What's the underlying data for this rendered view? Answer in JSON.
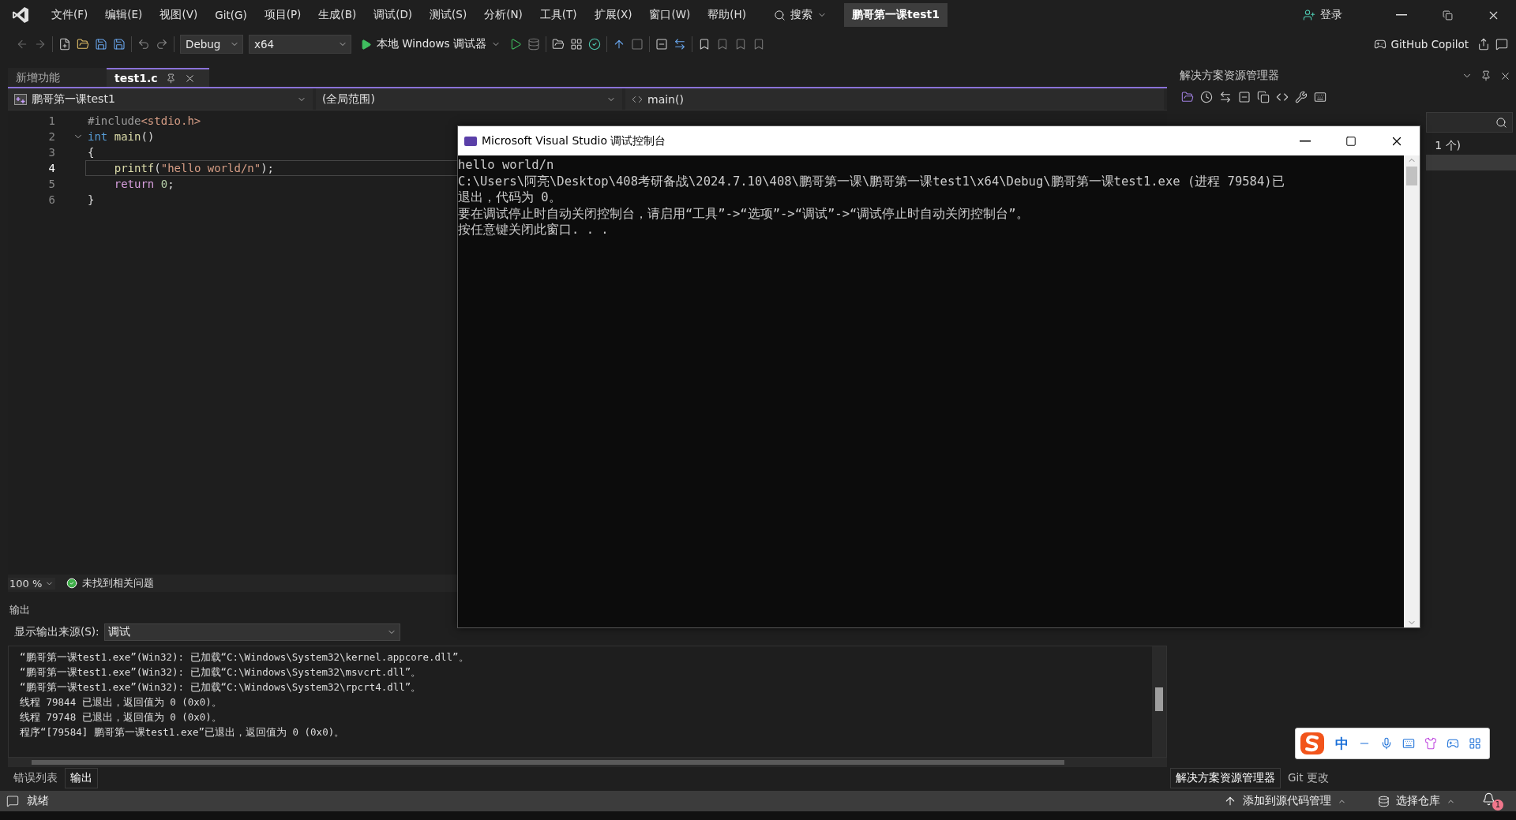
{
  "menu_bar": {
    "items": [
      "文件(F)",
      "编辑(E)",
      "视图(V)",
      "Git(G)",
      "项目(P)",
      "生成(B)",
      "调试(D)",
      "测试(S)",
      "分析(N)",
      "工具(T)",
      "扩展(X)",
      "窗口(W)",
      "帮助(H)"
    ],
    "search": "搜索",
    "title": "鹏哥第一课test1",
    "sign_in": "登录"
  },
  "toolbar": {
    "configuration": "Debug",
    "platform": "x64",
    "debugger": "本地 Windows 调试器",
    "copilot": "GitHub Copilot"
  },
  "document_tabs": [
    {
      "label": "新增功能",
      "selected": false
    },
    {
      "label": "test1.c",
      "selected": true
    }
  ],
  "navigation_bar": {
    "project": "鹏哥第一课test1",
    "scope": "(全局范围)",
    "member": "main()"
  },
  "editor": {
    "lines": [
      {
        "number": "1",
        "current": false,
        "tokens": [
          {
            "text": "#include",
            "kind": "directive"
          },
          {
            "text": "<stdio.h>",
            "kind": "header"
          }
        ]
      },
      {
        "number": "2",
        "current": false,
        "expanded": true,
        "tokens": [
          {
            "text": "int",
            "kind": "keyword"
          },
          {
            "text": " main",
            "kind": "function"
          },
          {
            "text": "()",
            "kind": "plain"
          }
        ]
      },
      {
        "number": "3",
        "current": false,
        "tokens": [
          {
            "text": "{",
            "kind": "plain"
          }
        ]
      },
      {
        "number": "4",
        "current": true,
        "tokens": [
          {
            "text": "    printf",
            "kind": "function"
          },
          {
            "text": "(",
            "kind": "plain"
          },
          {
            "text": "\"hello world/n\"",
            "kind": "string"
          },
          {
            "text": ");",
            "kind": "plain"
          }
        ]
      },
      {
        "number": "5",
        "current": false,
        "tokens": [
          {
            "text": "    return",
            "kind": "control"
          },
          {
            "text": " 0",
            "kind": "number"
          },
          {
            "text": ";",
            "kind": "plain"
          }
        ]
      },
      {
        "number": "6",
        "current": false,
        "tokens": [
          {
            "text": "}",
            "kind": "plain"
          }
        ]
      }
    ]
  },
  "editor_status": {
    "zoom": "100 %",
    "issues": "未找到相关问题"
  },
  "output": {
    "title": "输出",
    "source_label": "显示输出来源(S):",
    "source": "调试",
    "lines": [
      "“鹏哥第一课test1.exe”(Win32): 已加载“C:\\Windows\\System32\\kernel.appcore.dll”。",
      "“鹏哥第一课test1.exe”(Win32): 已加载“C:\\Windows\\System32\\msvcrt.dll”。",
      "“鹏哥第一课test1.exe”(Win32): 已加载“C:\\Windows\\System32\\rpcrt4.dll”。",
      "线程 79844 已退出，返回值为 0 (0x0)。",
      "线程 79748 已退出，返回值为 0 (0x0)。",
      "程序“[79584] 鹏哥第一课test1.exe”已退出，返回值为 0 (0x0)。"
    ]
  },
  "bottom_tabs": [
    {
      "label": "错误列表",
      "selected": false
    },
    {
      "label": "输出",
      "selected": true
    }
  ],
  "solution_explorer": {
    "title": "解决方案资源管理器",
    "visible_text": "1 个)",
    "tabs": [
      {
        "label": "解决方案资源管理器",
        "selected": true
      },
      {
        "label": "Git 更改",
        "selected": false
      }
    ]
  },
  "console_window": {
    "title": "Microsoft Visual Studio 调试控制台",
    "lines": [
      "hello world/n",
      "C:\\Users\\阿亮\\Desktop\\408考研备战\\2024.7.10\\408\\鹏哥第一课\\鹏哥第一课test1\\x64\\Debug\\鹏哥第一课test1.exe (进程 79584)已",
      "退出，代码为 0。",
      "要在调试停止时自动关闭控制台，请启用“工具”->“选项”->“调试”->“调试停止时自动关闭控制台”。",
      "按任意键关闭此窗口. . ."
    ]
  },
  "ime_toolbar": {
    "mode": "中"
  },
  "status_bar": {
    "status": "就绪",
    "add_to_source_control": "添加到源代码管理",
    "select_repository": "选择仓库",
    "notifications": "1"
  }
}
